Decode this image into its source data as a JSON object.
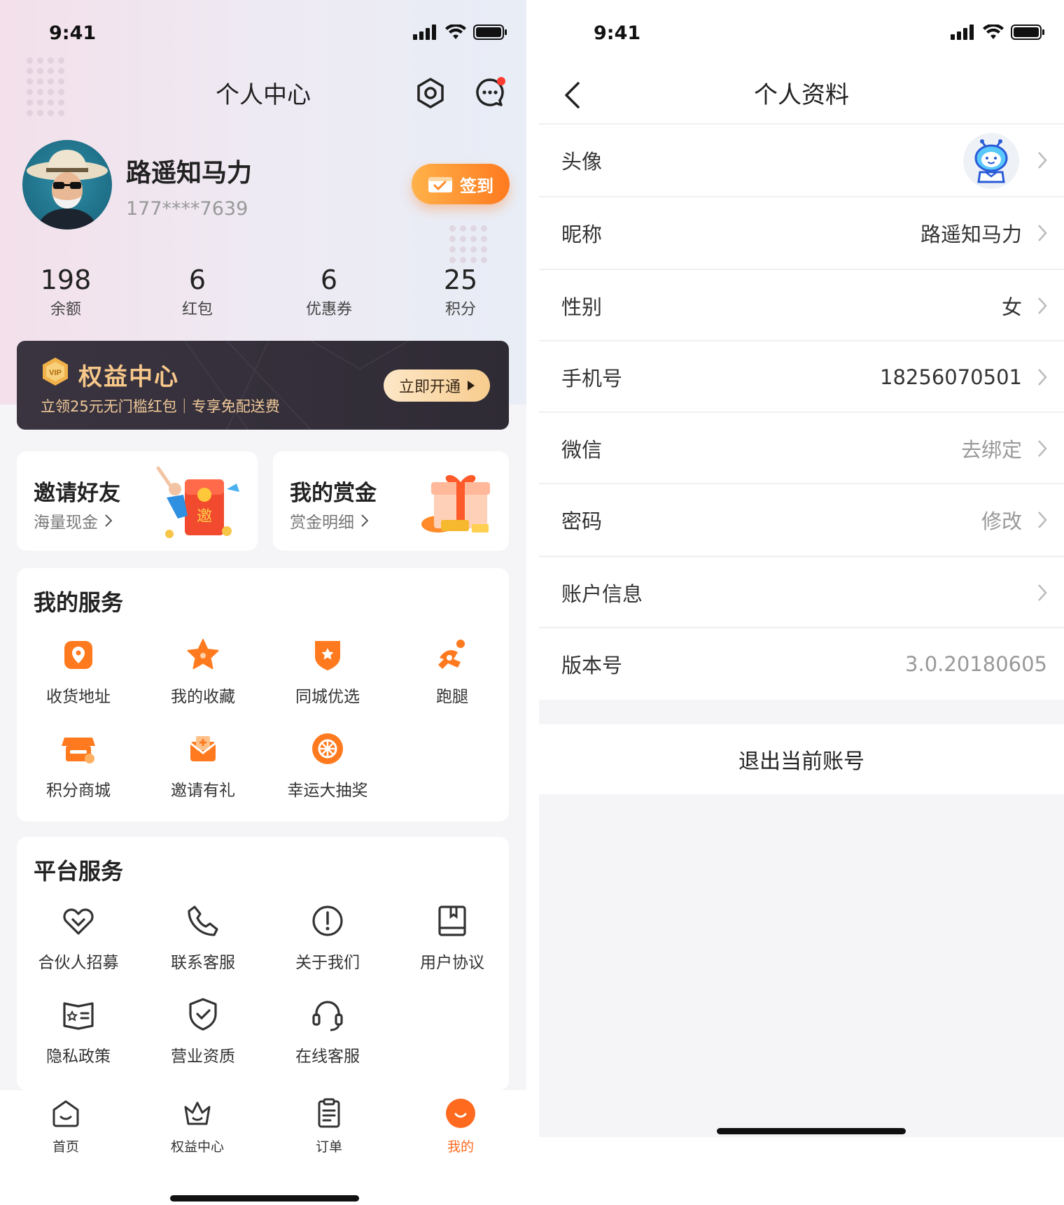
{
  "left": {
    "status": {
      "time": "9:41"
    },
    "title": "个人中心",
    "user": {
      "name": "路遥知马力",
      "phone": "177****7639"
    },
    "signin_label": "签到",
    "stats": [
      {
        "value": "198",
        "label": "余额"
      },
      {
        "value": "6",
        "label": "红包"
      },
      {
        "value": "6",
        "label": "优惠券"
      },
      {
        "value": "25",
        "label": "积分"
      }
    ],
    "vip": {
      "title": "权益中心",
      "subtitle": "立领25元无门槛红包｜专享免配送费",
      "button": "立即开通"
    },
    "promos": [
      {
        "title": "邀请好友",
        "subtitle": "海量现金"
      },
      {
        "title": "我的赏金",
        "subtitle": "赏金明细"
      }
    ],
    "my_services": {
      "title": "我的服务",
      "items": [
        {
          "label": "收货地址",
          "icon": "location-pin-icon"
        },
        {
          "label": "我的收藏",
          "icon": "star-icon"
        },
        {
          "label": "同城优选",
          "icon": "star-badge-icon"
        },
        {
          "label": "跑腿",
          "icon": "runner-icon"
        },
        {
          "label": "积分商城",
          "icon": "store-icon"
        },
        {
          "label": "邀请有礼",
          "icon": "gift-envelope-icon"
        },
        {
          "label": "幸运大抽奖",
          "icon": "lottery-wheel-icon"
        }
      ]
    },
    "platform_services": {
      "title": "平台服务",
      "items": [
        {
          "label": "合伙人招募",
          "icon": "handshake-icon"
        },
        {
          "label": "联系客服",
          "icon": "phone-icon"
        },
        {
          "label": "关于我们",
          "icon": "info-icon"
        },
        {
          "label": "用户协议",
          "icon": "book-icon"
        },
        {
          "label": "隐私政策",
          "icon": "privacy-card-icon"
        },
        {
          "label": "营业资质",
          "icon": "shield-check-icon"
        },
        {
          "label": "在线客服",
          "icon": "headset-icon"
        }
      ]
    },
    "tabs": [
      {
        "label": "首页",
        "icon": "home-icon"
      },
      {
        "label": "权益中心",
        "icon": "crown-icon"
      },
      {
        "label": "订单",
        "icon": "order-icon"
      },
      {
        "label": "我的",
        "icon": "me-icon"
      }
    ],
    "active_tab": "我的"
  },
  "right": {
    "status": {
      "time": "9:41"
    },
    "title": "个人资料",
    "rows": [
      {
        "label": "头像",
        "value": ""
      },
      {
        "label": "昵称",
        "value": "路遥知马力"
      },
      {
        "label": "性别",
        "value": "女"
      },
      {
        "label": "手机号",
        "value": "18256070501"
      },
      {
        "label": "微信",
        "value": "去绑定"
      },
      {
        "label": "密码",
        "value": "修改"
      },
      {
        "label": "账户信息",
        "value": ""
      },
      {
        "label": "版本号",
        "value": "3.0.20180605"
      }
    ],
    "logout": "退出当前账号"
  },
  "colors": {
    "accent": "#ff6a1f",
    "vip_gold": "#f7c88a",
    "notify_red": "#ff3b30"
  }
}
